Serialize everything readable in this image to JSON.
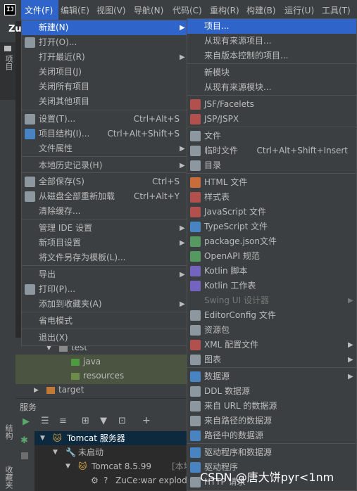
{
  "menubar": {
    "items": [
      "文件(F)",
      "编辑(E)",
      "视图(V)",
      "导航(N)",
      "代码(C)",
      "重构(R)",
      "构建(B)",
      "运行(U)",
      "工具(T)"
    ]
  },
  "left_strip": {
    "project_tab": "项目",
    "structure_tab": "结构",
    "favorites_tab": "收藏夹"
  },
  "project_name_fragment": "Zu",
  "project_tree": [
    {
      "label": "test"
    },
    {
      "label": "java"
    },
    {
      "label": "resources"
    },
    {
      "label": "target"
    }
  ],
  "services": {
    "title": "服务",
    "rows": [
      {
        "label": "Tomcat 服务器"
      },
      {
        "label": "未启动"
      },
      {
        "label": "Tomcat 8.5.99",
        "suffix": "[本地]"
      },
      {
        "label": "ZuCe:war explode"
      }
    ]
  },
  "file_menu": [
    {
      "label": "新建(N)",
      "arrow": true,
      "active": true
    },
    {
      "label": "打开(O)...",
      "icon": "folder-open-icon"
    },
    {
      "label": "打开最近(R)",
      "arrow": true
    },
    {
      "label": "关闭项目(J)"
    },
    {
      "label": "关闭所有项目"
    },
    {
      "label": "关闭其他项目"
    },
    {
      "label": "设置(T)...",
      "icon": "wrench-icon",
      "shortcut": "Ctrl+Alt+S"
    },
    {
      "label": "项目结构(I)...",
      "icon": "project-structure-icon",
      "shortcut": "Ctrl+Alt+Shift+S"
    },
    {
      "label": "文件属性",
      "arrow": true
    },
    {
      "label": "本地历史记录(H)",
      "arrow": true
    },
    {
      "label": "全部保存(S)",
      "icon": "save-icon",
      "shortcut": "Ctrl+S"
    },
    {
      "label": "从磁盘全部重新加载",
      "icon": "reload-icon",
      "shortcut": "Ctrl+Alt+Y"
    },
    {
      "label": "清除缓存..."
    },
    {
      "label": "管理 IDE 设置",
      "arrow": true
    },
    {
      "label": "新项目设置",
      "arrow": true
    },
    {
      "label": "将文件另存为模板(L)..."
    },
    {
      "label": "导出",
      "arrow": true
    },
    {
      "label": "打印(P)...",
      "icon": "print-icon"
    },
    {
      "label": "添加到收藏夹(A)",
      "arrow": true
    },
    {
      "label": "省电模式"
    },
    {
      "label": "退出(X)"
    }
  ],
  "new_submenu": [
    {
      "label": "项目...",
      "active": true
    },
    {
      "label": "从现有来源项目..."
    },
    {
      "label": "来自版本控制的项目..."
    },
    {
      "label": "新模块"
    },
    {
      "label": "从现有来源模块..."
    },
    {
      "label": "JSF/Facelets",
      "icon": "jsf-icon"
    },
    {
      "label": "JSP/JSPX",
      "icon": "jsp-icon"
    },
    {
      "label": "文件",
      "icon": "file-icon"
    },
    {
      "label": "临时文件",
      "icon": "scratch-file-icon",
      "shortcut": "Ctrl+Alt+Shift+Insert"
    },
    {
      "label": "目录",
      "icon": "folder-icon"
    },
    {
      "label": "HTML 文件",
      "icon": "html-icon"
    },
    {
      "label": "样式表",
      "icon": "css-icon"
    },
    {
      "label": "JavaScript 文件",
      "icon": "js-icon"
    },
    {
      "label": "TypeScript 文件",
      "icon": "ts-icon"
    },
    {
      "label": "package.json文件",
      "icon": "npm-icon"
    },
    {
      "label": "OpenAPI 规范",
      "icon": "openapi-icon"
    },
    {
      "label": "Kotlin 脚本",
      "icon": "kotlin-icon"
    },
    {
      "label": "Kotlin 工作表",
      "icon": "kotlin-worksheet-icon"
    },
    {
      "label": "Swing UI 设计器",
      "arrow": true,
      "disabled": true
    },
    {
      "label": "EditorConfig 文件",
      "icon": "gear-icon"
    },
    {
      "label": "资源包",
      "icon": "resource-bundle-icon"
    },
    {
      "label": "XML 配置文件",
      "icon": "xml-icon",
      "arrow": true
    },
    {
      "label": "图表",
      "icon": "diagram-icon",
      "arrow": true
    },
    {
      "label": "数据源",
      "icon": "datasource-icon",
      "arrow": true
    },
    {
      "label": "DDL 数据源",
      "icon": "ddl-icon"
    },
    {
      "label": "来自 URL 的数据源",
      "icon": "url-datasource-icon"
    },
    {
      "label": "来自路径的数据源",
      "icon": "path-datasource-icon"
    },
    {
      "label": "路径中的数据源",
      "icon": "db-in-path-icon"
    },
    {
      "label": "驱动程序和数据源",
      "icon": "driver-datasource-icon"
    },
    {
      "label": "驱动程序",
      "icon": "driver-icon"
    },
    {
      "label": "HTTP 请求",
      "icon": "http-icon"
    }
  ],
  "watermark": "CSDN @唐大饼pyr<1nm",
  "colors": {
    "accent": "#2f65ca",
    "menu_bg": "#3c3f41",
    "text": "#bbbbbb"
  }
}
